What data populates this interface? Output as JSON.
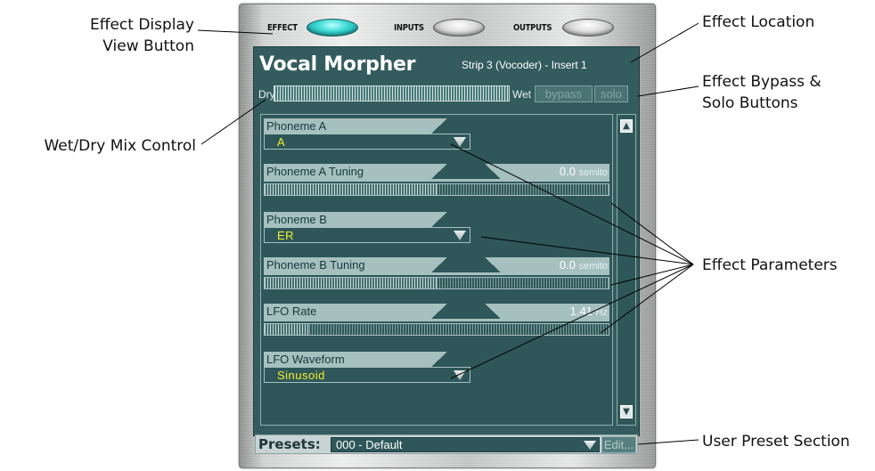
{
  "callouts": {
    "effect_display_view_button": "Effect Display\nView Button",
    "wet_dry_mix_control": "Wet/Dry Mix Control",
    "effect_location": "Effect Location",
    "effect_bypass_solo": "Effect Bypass &\nSolo Buttons",
    "effect_parameters": "Effect Parameters",
    "user_preset_section": "User Preset Section"
  },
  "topbar": {
    "effect_label": "EFFECT",
    "inputs_label": "INPUTS",
    "outputs_label": "OUTPUTS",
    "active_view": "EFFECT"
  },
  "header": {
    "title": "Vocal Morpher",
    "location": "Strip 3 (Vocoder) - Insert 1"
  },
  "mix": {
    "dry_label": "Dry",
    "wet_label": "Wet",
    "bypass_label": "bypass",
    "solo_label": "solo"
  },
  "params": [
    {
      "name": "Phoneme A",
      "kind": "select",
      "value": "A"
    },
    {
      "name": "Phoneme A Tuning",
      "kind": "slider",
      "value": "0.0",
      "unit": "semito",
      "level": 0.5
    },
    {
      "name": "Phoneme B",
      "kind": "select",
      "value": "ER"
    },
    {
      "name": "Phoneme B Tuning",
      "kind": "slider",
      "value": "0.0",
      "unit": "semito",
      "level": 0.5
    },
    {
      "name": "LFO Rate",
      "kind": "slider",
      "value": "1.41",
      "unit": "Hz",
      "level": 0.13
    },
    {
      "name": "LFO Waveform",
      "kind": "select",
      "value": "Sinusoid"
    }
  ],
  "presets": {
    "label": "Presets:",
    "value": "000 - Default",
    "edit_label": "Edit..."
  },
  "colors": {
    "panel": "#345c5e",
    "value_yellow": "#f2ef30",
    "active_button": "#38d6d2"
  }
}
